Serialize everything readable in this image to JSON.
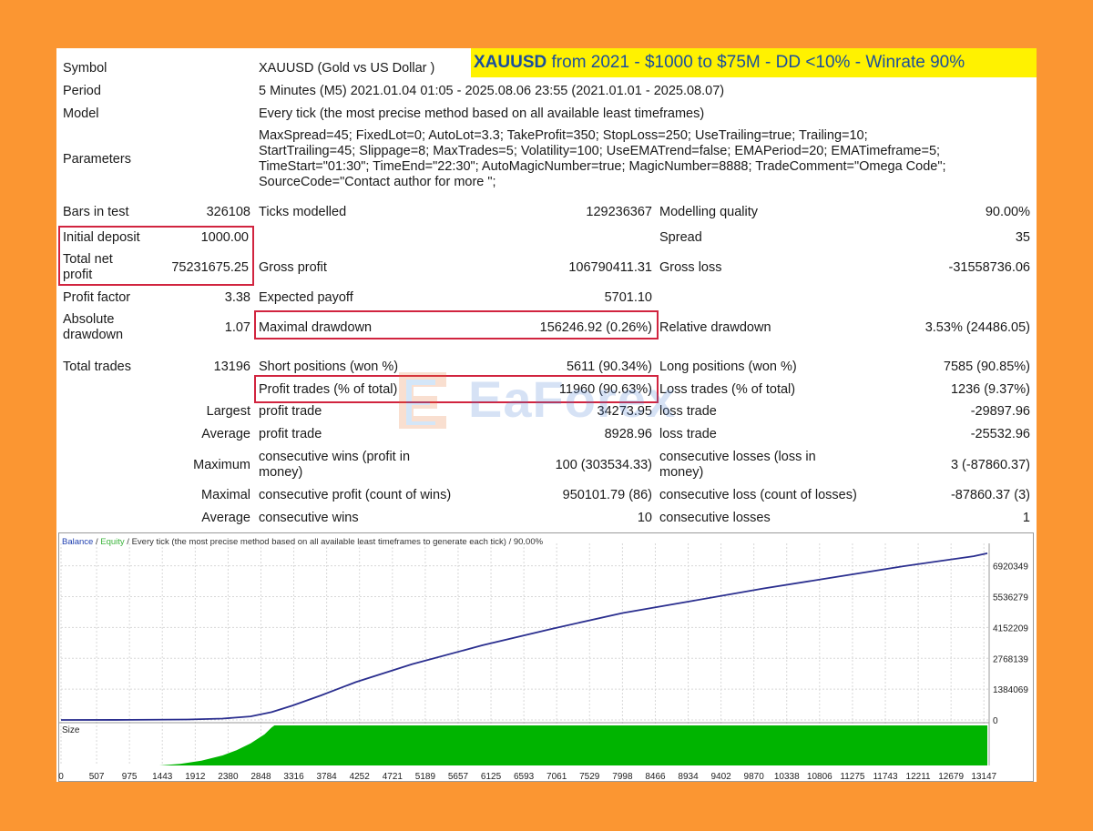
{
  "banner": {
    "pair": "XAUUSD",
    "rest": "from 2021 - $1000 to $75M - DD <10% - Winrate 90%"
  },
  "report": {
    "symbol_label": "Symbol",
    "symbol_value": "XAUUSD (Gold vs US Dollar )",
    "period_label": "Period",
    "period_value": "5 Minutes (M5) 2021.01.04 01:05 - 2025.08.06 23:55 (2021.01.01 - 2025.08.07)",
    "model_label": "Model",
    "model_value": "Every tick (the most precise method based on all available least timeframes)",
    "params_label": "Parameters",
    "params_lines": [
      "MaxSpread=45; FixedLot=0; AutoLot=3.3; TakeProfit=350; StopLoss=250; UseTrailing=true; Trailing=10;",
      "StartTrailing=45; Slippage=8; MaxTrades=5; Volatility=100; UseEMATrend=false; EMAPeriod=20; EMATimeframe=5;",
      "TimeStart=\"01:30\"; TimeEnd=\"22:30\"; AutoMagicNumber=true; MagicNumber=8888; TradeComment=\"Omega Code\";",
      "SourceCode=\"Contact author for more \";"
    ],
    "bars_label": "Bars in test",
    "bars_value": "326108",
    "ticks_label": "Ticks modelled",
    "ticks_value": "129236367",
    "mq_label": "Modelling quality",
    "mq_value": "90.00%",
    "deposit_label": "Initial deposit",
    "deposit_value": "1000.00",
    "spread_label": "Spread",
    "spread_value": "35",
    "netprofit_label_1": "Total net",
    "netprofit_label_2": "profit",
    "netprofit_value": "75231675.25",
    "grossprofit_label": "Gross profit",
    "grossprofit_value": "106790411.31",
    "grossloss_label": "Gross loss",
    "grossloss_value": "-31558736.06",
    "pf_label": "Profit factor",
    "pf_value": "3.38",
    "ep_label": "Expected payoff",
    "ep_value": "5701.10",
    "absdd_label_1": "Absolute",
    "absdd_label_2": "drawdown",
    "absdd_value": "1.07",
    "maxdd_label": "Maximal drawdown",
    "maxdd_value": "156246.92 (0.26%)",
    "reldd_label": "Relative drawdown",
    "reldd_value": "3.53% (24486.05)",
    "trades_label": "Total trades",
    "trades_value": "13196",
    "short_label": "Short positions (won %)",
    "short_value": "5611 (90.34%)",
    "long_label": "Long positions (won %)",
    "long_value": "7585 (90.85%)",
    "ptrades_label": "Profit trades (% of total)",
    "ptrades_value": "11960 (90.63%)",
    "ltrades_label": "Loss trades (% of total)",
    "ltrades_value": "1236 (9.37%)",
    "largest_label": "Largest",
    "largest_profit_label": "profit trade",
    "largest_profit_value": "34273.95",
    "largest_loss_label": "loss trade",
    "largest_loss_value": "-29897.96",
    "average_label": "Average",
    "average_profit_label": "profit trade",
    "average_profit_value": "8928.96",
    "average_loss_label": "loss trade",
    "average_loss_value": "-25532.96",
    "maximum_label": "Maximum",
    "cw_label_1": "consecutive wins (profit in",
    "cw_label_2": "money)",
    "cw_value": "100 (303534.33)",
    "cl_label_1": "consecutive losses (loss in",
    "cl_label_2": "money)",
    "cl_value": "3 (-87860.37)",
    "maximal_label": "Maximal",
    "cp_label": "consecutive profit (count of wins)",
    "cp_value": "950101.79 (86)",
    "closs_label": "consecutive loss (count of losses)",
    "closs_value": "-87860.37 (3)",
    "average2_label": "Average",
    "acw_label": "consecutive wins",
    "acw_value": "10",
    "acl_label": "consecutive losses",
    "acl_value": "1"
  },
  "watermark": "EaForex",
  "chart_data": {
    "type": "line",
    "header": {
      "balance": "Balance",
      "sep1": " / ",
      "equity": "Equity",
      "rest": " / Every tick (the most precise method based on all available least timeframes to generate each tick) / 90.00%"
    },
    "size_label": "Size",
    "x_ticks": [
      "0",
      "507",
      "975",
      "1443",
      "1912",
      "2380",
      "2848",
      "3316",
      "3784",
      "4252",
      "4721",
      "5189",
      "5657",
      "6125",
      "6593",
      "7061",
      "7529",
      "7998",
      "8466",
      "8934",
      "9402",
      "9870",
      "10338",
      "10806",
      "11275",
      "11743",
      "12211",
      "12679",
      "13147"
    ],
    "y_ticks": [
      "6920349",
      "5536279",
      "4152209",
      "2768139",
      "1384069",
      "0"
    ],
    "xlim": [
      0,
      13196
    ],
    "ylim": [
      0,
      7600000
    ],
    "balance_series": {
      "x": [
        0,
        1000,
        1800,
        2300,
        2700,
        3000,
        3300,
        3700,
        4200,
        5000,
        6000,
        7000,
        8000,
        9000,
        10000,
        11000,
        12000,
        13000,
        13196
      ],
      "y": [
        1000,
        5000,
        20000,
        60000,
        160000,
        350000,
        650000,
        1100000,
        1700000,
        2500000,
        3350000,
        4100000,
        4800000,
        5350000,
        5900000,
        6400000,
        6900000,
        7350000,
        7480000
      ]
    },
    "size_series": {
      "x": [
        1400,
        1700,
        2000,
        2300,
        2500,
        2700,
        2900,
        3000,
        3040,
        13196
      ],
      "y": [
        0,
        0.04,
        0.12,
        0.25,
        0.38,
        0.55,
        0.78,
        0.95,
        1.0,
        1.0
      ]
    },
    "colors": {
      "balance": "#2b2f8f",
      "equity": "#3cb43c",
      "size": "#00b400",
      "grid": "#d8d8d8"
    }
  }
}
